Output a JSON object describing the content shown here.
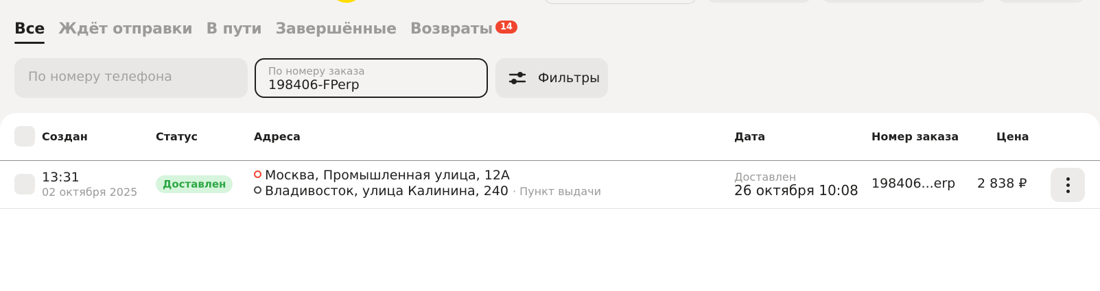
{
  "tabs": [
    {
      "label": "Все",
      "active": true
    },
    {
      "label": "Ждёт отправки"
    },
    {
      "label": "В пути"
    },
    {
      "label": "Завершённые"
    },
    {
      "label": "Возвраты",
      "badge": "14"
    }
  ],
  "filters": {
    "phone_placeholder": "По номеру телефона",
    "order_label": "По номеру заказа",
    "order_value": "198406-FPerp",
    "filters_button": "Фильтры"
  },
  "table": {
    "headers": {
      "created": "Создан",
      "status": "Статус",
      "addresses": "Адреса",
      "date": "Дата",
      "order_number": "Номер заказа",
      "price": "Цена"
    },
    "rows": [
      {
        "time": "13:31",
        "created_date": "02 октября 2025",
        "status": "Доставлен",
        "from": "Москва, Промышленная улица, 12А",
        "to": "Владивосток, улица Калинина, 240",
        "to_note": "· Пункт выдачи",
        "date_label": "Доставлен",
        "date_value": "26 октября 10:08",
        "order_number": "198406...erp",
        "price": "2 838 ₽"
      }
    ]
  },
  "colors": {
    "accent": "#ffdd00",
    "badge": "#f0452f",
    "status_bg": "#d6f5dc",
    "status_text": "#2ea845",
    "background": "#f4f3f1"
  },
  "icons": {
    "filters": "sliders-icon",
    "more": "more-vertical-icon",
    "from_dot": "origin-dot-icon",
    "to_dot": "destination-dot-icon"
  }
}
